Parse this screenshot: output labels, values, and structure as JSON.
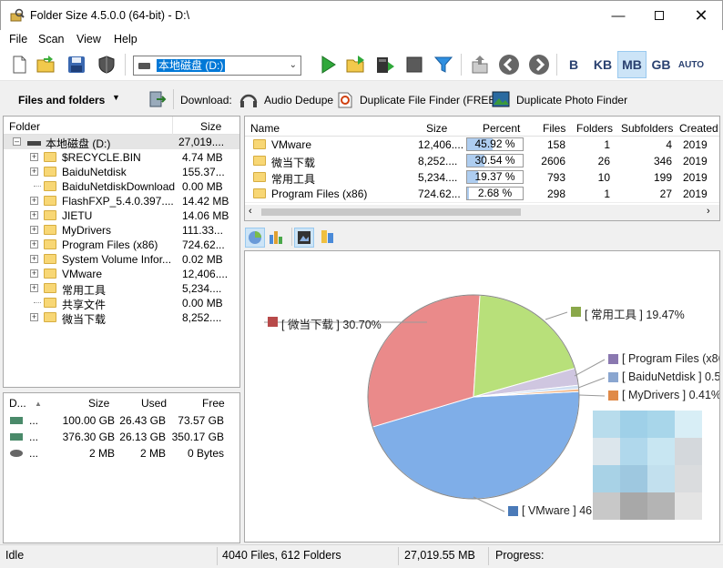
{
  "window": {
    "title": "Folder Size 4.5.0.0 (64-bit) - D:\\"
  },
  "menu": [
    "File",
    "Scan",
    "View",
    "Help"
  ],
  "drive_combo": {
    "value": "本地磁盘 (D:)"
  },
  "units": [
    "B",
    "KB",
    "MB",
    "GB",
    "AUTO"
  ],
  "toolbar2": {
    "view_label": "Files and folders",
    "download_label": "Download:",
    "links": [
      "Audio Dedupe",
      "Duplicate File Finder (FREE)",
      "Duplicate Photo Finder"
    ]
  },
  "tree": {
    "headers": {
      "folder": "Folder",
      "size": "Size"
    },
    "root": {
      "name": "本地磁盘 (D:)",
      "size": "27,019...."
    },
    "items": [
      {
        "name": "$RECYCLE.BIN",
        "size": "4.74 MB",
        "expand": true
      },
      {
        "name": "BaiduNetdisk",
        "size": "155.37...",
        "expand": true
      },
      {
        "name": "BaiduNetdiskDownload",
        "size": "0.00 MB",
        "expand": false
      },
      {
        "name": "FlashFXP_5.4.0.397....",
        "size": "14.42 MB",
        "expand": true
      },
      {
        "name": "JIETU",
        "size": "14.06 MB",
        "expand": true
      },
      {
        "name": "MyDrivers",
        "size": "111.33...",
        "expand": true
      },
      {
        "name": "Program Files (x86)",
        "size": "724.62...",
        "expand": true
      },
      {
        "name": "System Volume Infor...",
        "size": "0.02 MB",
        "expand": true
      },
      {
        "name": "VMware",
        "size": "12,406....",
        "expand": true
      },
      {
        "name": "常用工具",
        "size": "5,234....",
        "expand": true
      },
      {
        "name": "共享文件",
        "size": "0.00 MB",
        "expand": false
      },
      {
        "name": "微当下载",
        "size": "8,252....",
        "expand": true
      }
    ]
  },
  "drives": {
    "headers": {
      "drive": "D...",
      "size": "Size",
      "used": "Used",
      "free": "Free"
    },
    "rows": [
      {
        "name": "...",
        "size": "100.00 GB",
        "used": "26.43 GB",
        "free": "73.57 GB"
      },
      {
        "name": "...",
        "size": "376.30 GB",
        "used": "26.13 GB",
        "free": "350.17 GB"
      },
      {
        "name": "...",
        "size": "2 MB",
        "used": "2 MB",
        "free": "0 Bytes"
      }
    ]
  },
  "list": {
    "headers": {
      "name": "Name",
      "size": "Size",
      "percent": "Percent",
      "files": "Files",
      "folders": "Folders",
      "subfolders": "Subfolders",
      "created": "Created"
    },
    "rows": [
      {
        "name": "VMware",
        "size": "12,406....",
        "percent": "45.92 %",
        "pct": 45.92,
        "files": "158",
        "folders": "1",
        "subfolders": "4",
        "created": "2019"
      },
      {
        "name": "微当下载",
        "size": "8,252....",
        "percent": "30.54 %",
        "pct": 30.54,
        "files": "2606",
        "folders": "26",
        "subfolders": "346",
        "created": "2019"
      },
      {
        "name": "常用工具",
        "size": "5,234....",
        "percent": "19.37 %",
        "pct": 19.37,
        "files": "793",
        "folders": "10",
        "subfolders": "199",
        "created": "2019"
      },
      {
        "name": "Program Files (x86)",
        "size": "724.62...",
        "percent": "2.68 %",
        "pct": 2.68,
        "files": "298",
        "folders": "1",
        "subfolders": "27",
        "created": "2019"
      }
    ]
  },
  "chart_data": {
    "type": "pie",
    "slices": [
      {
        "label": "[ VMware ] 46",
        "value": 46.0,
        "color": "#7faee8"
      },
      {
        "label": "[ 微当下载 ] 30.70%",
        "value": 30.7,
        "color": "#ea8a8a"
      },
      {
        "label": "[ 常用工具 ] 19.47%",
        "value": 19.47,
        "color": "#b8e07a"
      },
      {
        "label": "[ Program Files (x86",
        "value": 2.7,
        "color": "#cfc6e0"
      },
      {
        "label": "[ BaiduNetdisk ] 0.5",
        "value": 0.58,
        "color": "#cfdff2"
      },
      {
        "label": "[ MyDrivers ] 0.41%",
        "value": 0.41,
        "color": "#f2b07c"
      }
    ],
    "legend_colors": [
      "#4a7ab8",
      "#b84a4a",
      "#8aa84a",
      "#8a78b0",
      "#8aa6d0",
      "#e08a48"
    ]
  },
  "status": {
    "state": "Idle",
    "counts": "4040 Files, 612 Folders",
    "total": "27,019.55 MB",
    "progress_label": "Progress:"
  }
}
